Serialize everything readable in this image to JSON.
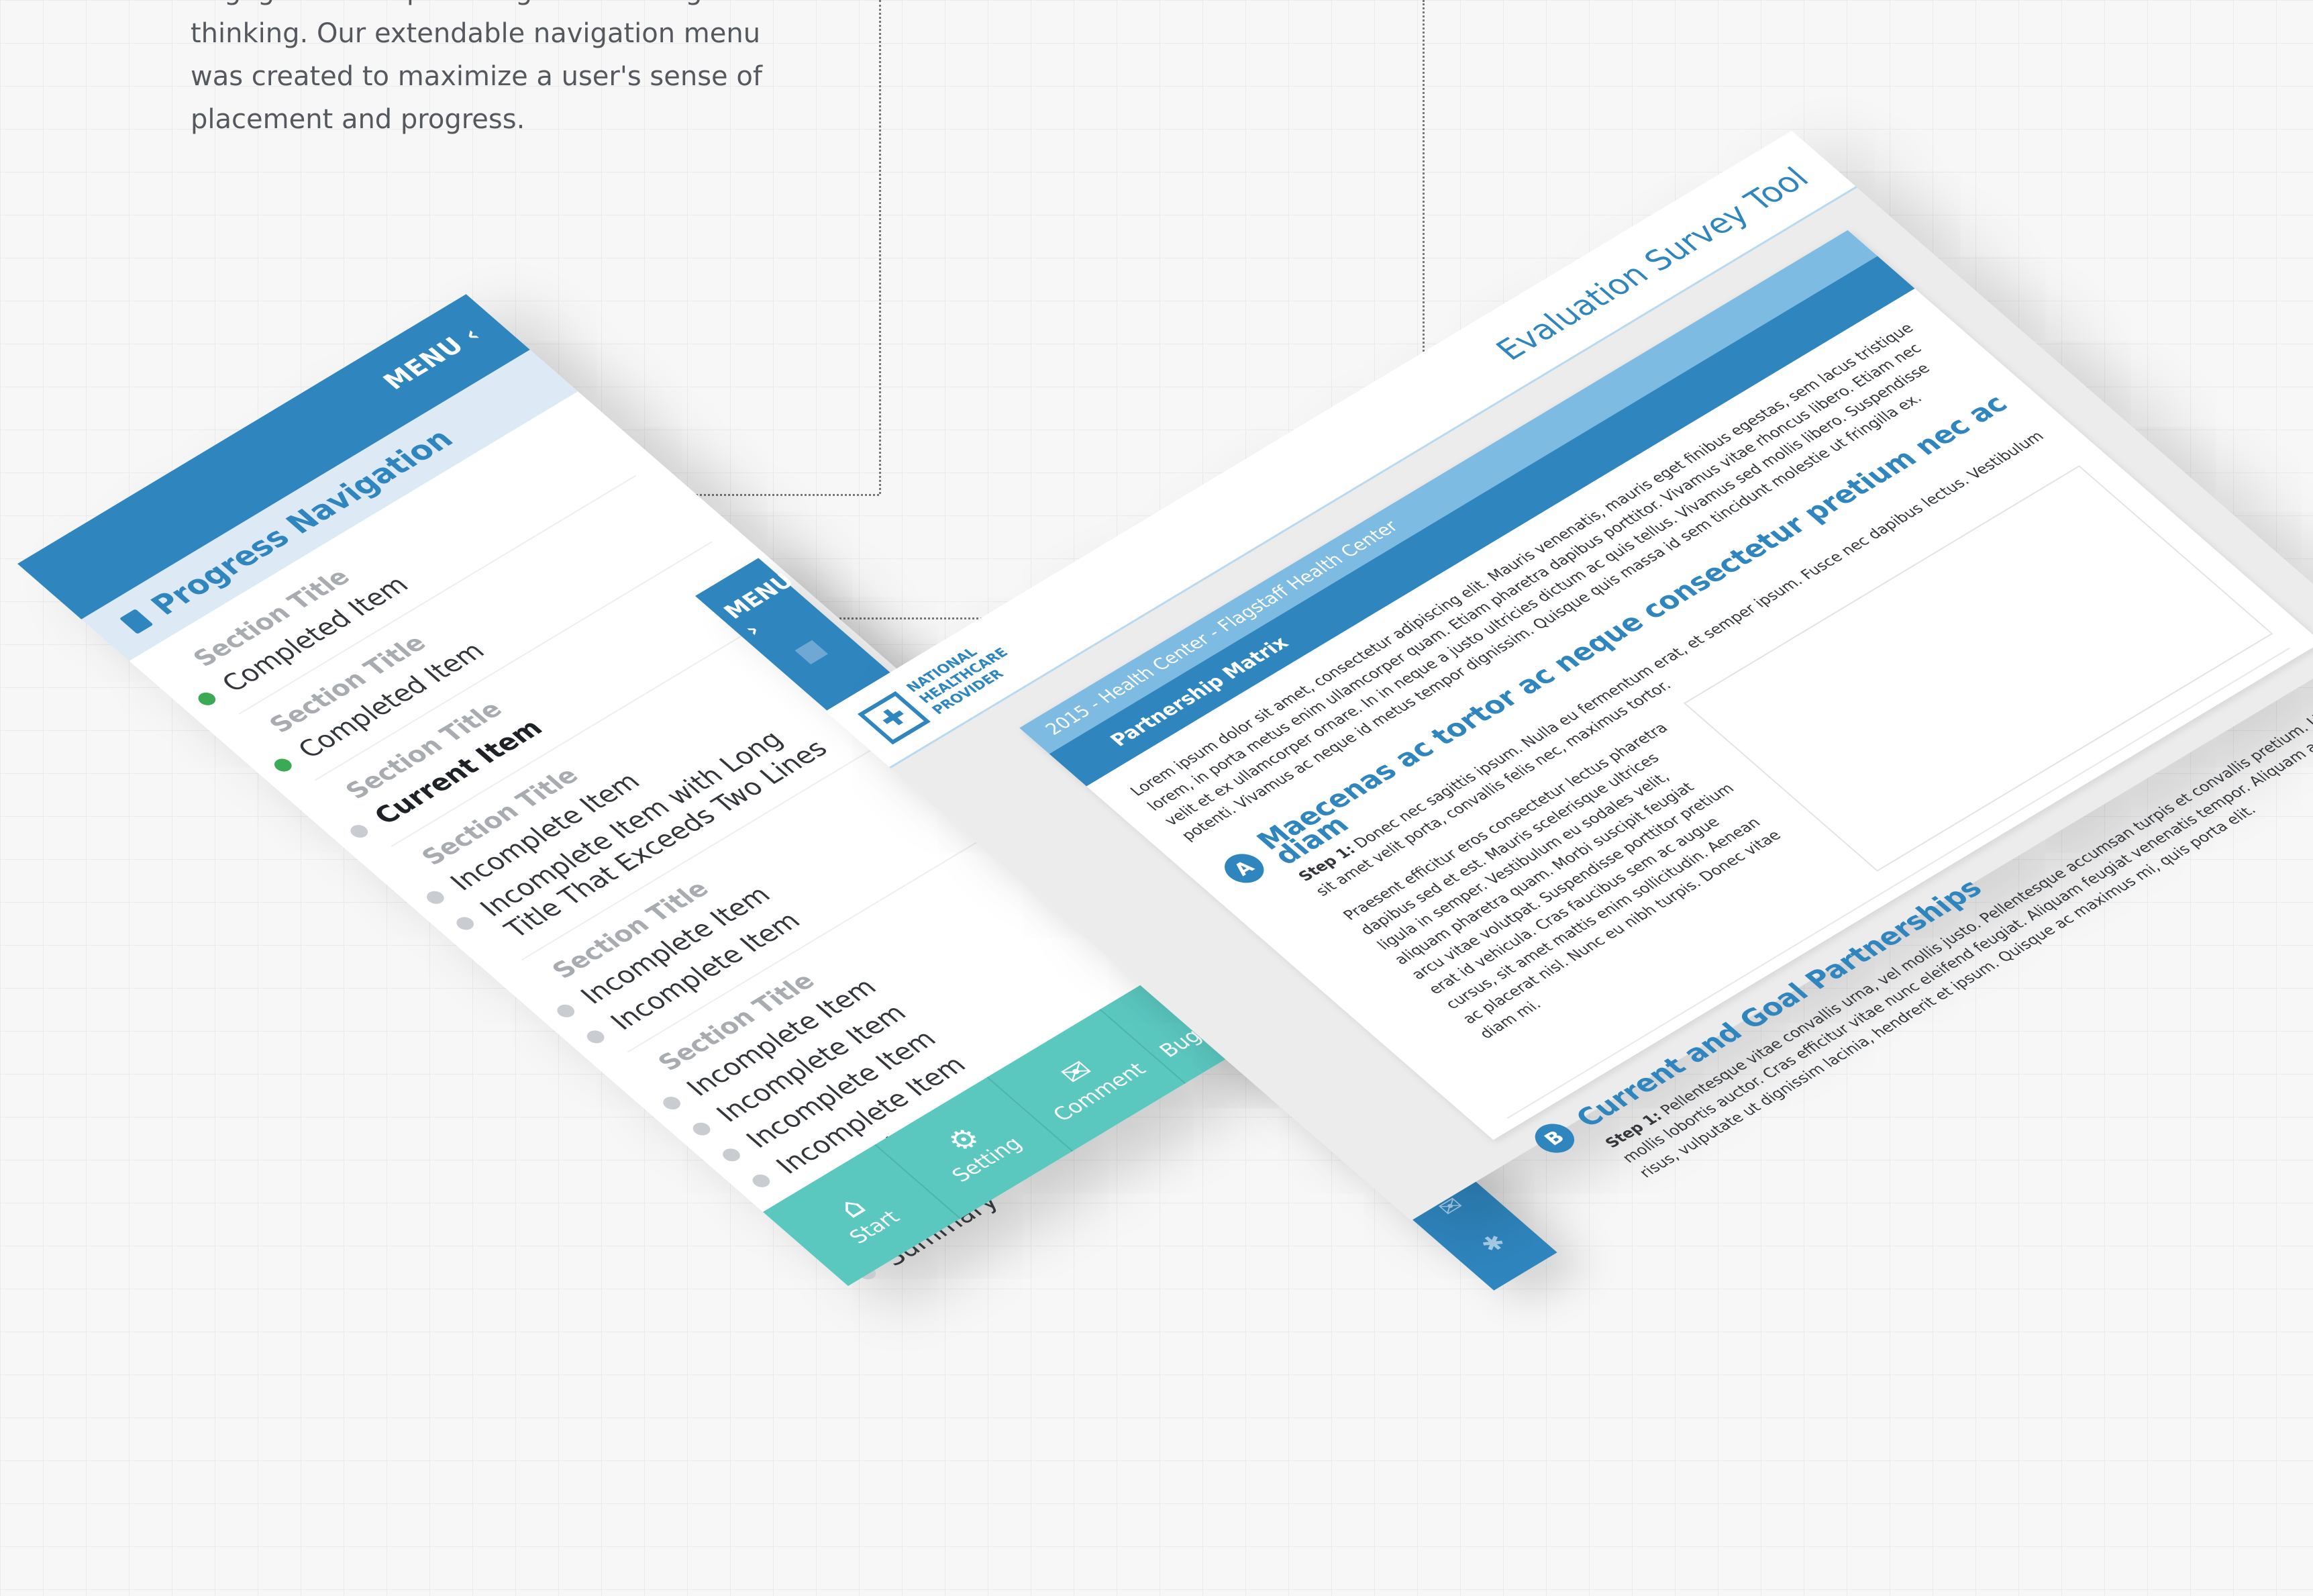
{
  "intro": {
    "text": "engagement required high level design thinking.  Our extendable navigation menu was created to maximize a user's sense of placement and progress."
  },
  "colors": {
    "primary": "#2f86bf",
    "light": "#dde9f5",
    "teal": "#5bc8c0",
    "done": "#3aaa55",
    "marker": "#cc1322"
  },
  "nav": {
    "menu_label": "MENU ‹",
    "header": "Progress Navigation",
    "header_icon": "book-icon",
    "groups": [
      {
        "title": "Section Title",
        "items": [
          {
            "label": "Completed Item",
            "status": "done"
          }
        ]
      },
      {
        "title": "Section Title",
        "items": [
          {
            "label": "Completed Item",
            "status": "done"
          }
        ]
      },
      {
        "title": "Section Title",
        "items": [
          {
            "label": "Current Item",
            "status": "current"
          }
        ]
      },
      {
        "title": "Section Title",
        "items": [
          {
            "label": "Incomplete Item",
            "status": "todo"
          },
          {
            "label": "Incomplete Item with Long Title That Exceeds Two Lines",
            "status": "todo"
          }
        ]
      },
      {
        "title": "Section Title",
        "items": [
          {
            "label": "Incomplete Item",
            "status": "todo"
          },
          {
            "label": "Incomplete Item",
            "status": "todo"
          }
        ]
      },
      {
        "title": "Section Title",
        "items": [
          {
            "label": "Incomplete Item",
            "status": "todo"
          },
          {
            "label": "Incomplete Item",
            "status": "todo"
          },
          {
            "label": "Incomplete Item",
            "status": "todo"
          },
          {
            "label": "Incomplete Item",
            "status": "todo"
          },
          {
            "label": "Incomplete Item",
            "status": "todo"
          }
        ]
      },
      {
        "title": "Summary",
        "items": [
          {
            "label": "Summary",
            "status": "todo"
          }
        ]
      }
    ],
    "bottom": [
      {
        "label": "Start",
        "icon": "home-icon",
        "glyph": "⌂"
      },
      {
        "label": "Setting",
        "icon": "gear-icon",
        "glyph": "⚙"
      },
      {
        "label": "Comment",
        "icon": "comment-icon",
        "glyph": "✉"
      },
      {
        "label": "Bug Report",
        "icon": "bug-icon",
        "glyph": "✱"
      }
    ]
  },
  "strip": {
    "menu_label": "MENU ›",
    "icons": [
      "⌂",
      "⚙",
      "✉",
      "✱"
    ]
  },
  "screen": {
    "logo_lines": "NATIONAL HEALTHCARE PROVIDER",
    "tool_title": "Evaluation Survey Tool",
    "breadcrumb": "2015 - Health Center - Flagstaff Health Center",
    "tab": "Partnership Matrix",
    "intro": "Lorem ipsum dolor sit amet, consectetur adipiscing elit. Mauris venenatis, mauris eget finibus egestas, sem lacus tristique lorem, in porta metus enim ullamcorper quam. Etiam pharetra dapibus porttitor. Vivamus vitae rhoncus libero. Etiam nec velit et ex ullamcorper ornare. In in neque a justo ultricies dictum ac quis tellus. Vivamus sed mollis libero. Suspendisse potenti. Vivamus ac neque id metus tempor dignissim. Quisque quis massa id sem tincidunt molestie ut fringilla ex.",
    "section_a": {
      "badge": "A",
      "title": "Maecenas ac tortor ac neque consectetur pretium nec ac diam",
      "step_label": "Step 1:",
      "step_text": "Donec nec sagittis ipsum. Nulla eu fermentum erat, et semper ipsum. Fusce nec dapibus lectus. Vestibulum sit amet velit porta, convallis felis nec, maximus tortor.",
      "body": "Praesent efficitur eros consectetur lectus pharetra dapibus sed et est. Mauris scelerisque ultrices ligula in semper. Vestibulum eu sodales velit, aliquam pharetra quam. Morbi suscipit feugiat arcu vitae volutpat. Suspendisse porttitor pretium erat id vehicula. Cras faucibus sem ac augue cursus, sit amet mattis enim sollicitudin. Aenean ac placerat nisl. Nunc eu nibh turpis. Donec vitae diam mi."
    },
    "section_b": {
      "badge": "B",
      "title": "Current and Goal Partnerships",
      "step_label": "Step 1:",
      "step_text": "Pellentesque vitae convallis urna, vel mollis justo. Pellentesque accumsan turpis et convallis pretium. Ut mollis lobortis auctor. Cras efficitur vitae nunc eleifend feugiat. Aliquam feugiat venenatis tempor. Aliquam arcu risus, vulputate ut dignissim lacinia, hendrerit et ipsum. Quisque ac maximus mi, quis porta elit."
    }
  }
}
